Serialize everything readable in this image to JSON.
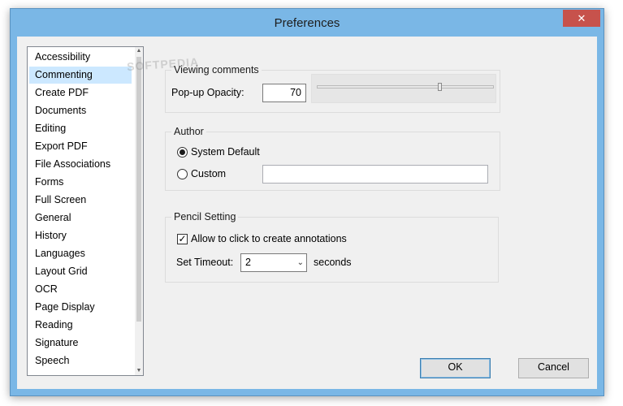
{
  "window": {
    "title": "Preferences",
    "close_glyph": "✕"
  },
  "categories": [
    "Accessibility",
    "Commenting",
    "Create PDF",
    "Documents",
    "Editing",
    "Export PDF",
    "File Associations",
    "Forms",
    "Full Screen",
    "General",
    "History",
    "Languages",
    "Layout Grid",
    "OCR",
    "Page Display",
    "Reading",
    "Signature",
    "Speech"
  ],
  "selected_category": "Commenting",
  "viewing_comments": {
    "legend": "Viewing comments",
    "opacity_label": "Pop-up Opacity:",
    "opacity_value": "70",
    "opacity_fraction": 0.7
  },
  "author": {
    "legend": "Author",
    "system_default_label": "System Default",
    "system_default_selected": true,
    "custom_label": "Custom",
    "custom_value": ""
  },
  "pencil": {
    "legend": "Pencil Setting",
    "allow_label": "Allow to click to create annotations",
    "allow_checked": true,
    "timeout_label": "Set Timeout:",
    "timeout_value": "2",
    "seconds_label": "seconds"
  },
  "buttons": {
    "ok": "OK",
    "cancel": "Cancel"
  },
  "watermark": "SOFTPEDIA",
  "colors": {
    "titlebar": "#7ab7e6",
    "close_button": "#c7524c",
    "selection": "#cce8ff"
  },
  "icons": {
    "close": "close-icon",
    "check": "check-icon",
    "dropdown": "chevron-down-icon"
  }
}
